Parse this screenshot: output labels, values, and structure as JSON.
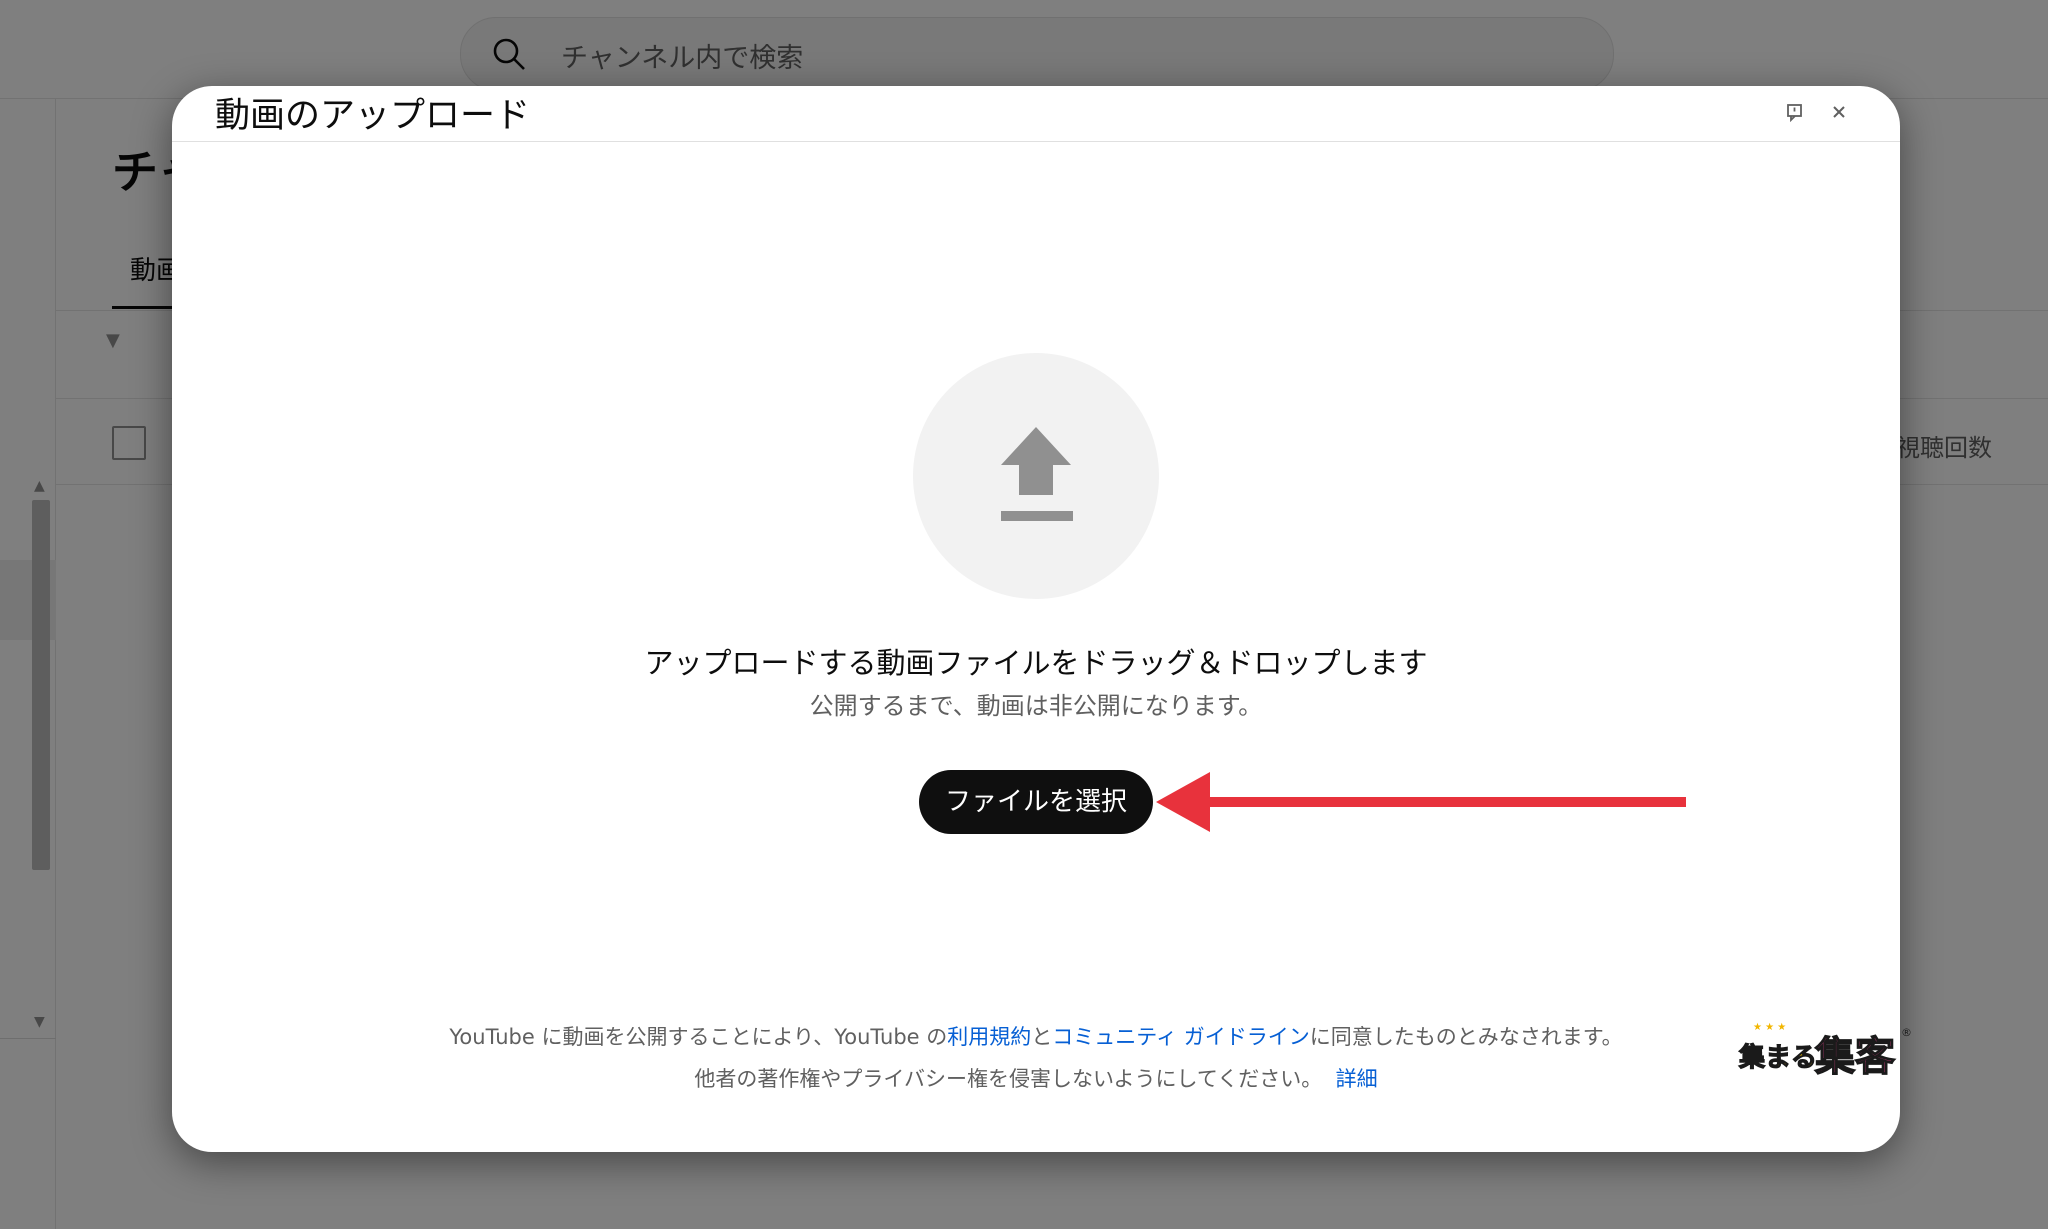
{
  "background": {
    "search_placeholder": "チャンネル内で検索",
    "page_title_partial": "チャ",
    "tab_partial": "動画",
    "column_views": "視聴回数"
  },
  "dialog": {
    "title": "動画のアップロード",
    "drop_text": "アップロードする動画ファイルをドラッグ＆ドロップします",
    "drop_subtext": "公開するまで、動画は非公開になります。",
    "select_button": "ファイルを選択",
    "terms_prefix": "YouTube に動画を公開することにより、YouTube の",
    "terms_link": "利用規約",
    "terms_and": "と",
    "guidelines_link": "コミュニティ ガイドライン",
    "terms_suffix": "に同意したものとみなされます。",
    "copyright_text": "他者の著作権やプライバシー権を侵害しないようにしてください。",
    "details_link": "詳細"
  },
  "watermark": {
    "text": "集まる集客"
  },
  "colors": {
    "link": "#065fd4",
    "button_bg": "#0f0f0f",
    "arrow": "#e8323c",
    "icon_gray": "#909090"
  },
  "icons": [
    "search-icon",
    "feedback-icon",
    "close-icon",
    "upload-icon",
    "arrow-annotation"
  ]
}
